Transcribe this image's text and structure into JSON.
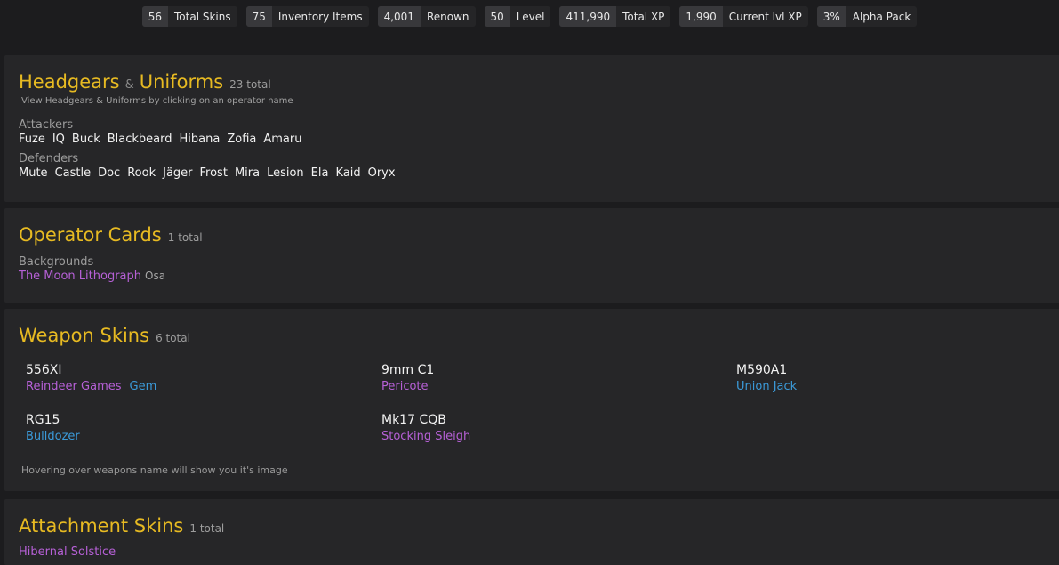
{
  "stats": [
    {
      "value": "56",
      "label": "Total Skins"
    },
    {
      "value": "75",
      "label": "Inventory Items"
    },
    {
      "value": "4,001",
      "label": "Renown"
    },
    {
      "value": "50",
      "label": "Level"
    },
    {
      "value": "411,990",
      "label": "Total XP"
    },
    {
      "value": "1,990",
      "label": "Current lvl XP"
    },
    {
      "value": "3%",
      "label": "Alpha Pack"
    }
  ],
  "headgears": {
    "title_a": "Headgears",
    "amp": "&",
    "title_b": "Uniforms",
    "total": "23 total",
    "hint": "View Headgears & Uniforms by clicking on an operator name",
    "attackers_label": "Attackers",
    "attackers": [
      "Fuze",
      "IQ",
      "Buck",
      "Blackbeard",
      "Hibana",
      "Zofia",
      "Amaru"
    ],
    "defenders_label": "Defenders",
    "defenders": [
      "Mute",
      "Castle",
      "Doc",
      "Rook",
      "Jäger",
      "Frost",
      "Mira",
      "Lesion",
      "Ela",
      "Kaid",
      "Oryx"
    ]
  },
  "operator_cards": {
    "title": "Operator Cards",
    "total": "1 total",
    "backgrounds_label": "Backgrounds",
    "item_name": "The Moon Lithograph",
    "item_owner": "Osa"
  },
  "weapon_skins": {
    "title": "Weapon Skins",
    "total": "6 total",
    "weapons": [
      {
        "name": "556XI",
        "skins": [
          {
            "name": "Reindeer Games",
            "color": "#b660d6"
          },
          {
            "name": "Gem",
            "color": "#3b9ad9"
          }
        ]
      },
      {
        "name": "9mm C1",
        "skins": [
          {
            "name": "Pericote",
            "color": "#b660d6"
          }
        ]
      },
      {
        "name": "M590A1",
        "skins": [
          {
            "name": "Union Jack",
            "color": "#3b9ad9"
          }
        ]
      },
      {
        "name": "RG15",
        "skins": [
          {
            "name": "Bulldozer",
            "color": "#3b9ad9"
          }
        ]
      },
      {
        "name": "Mk17 CQB",
        "skins": [
          {
            "name": "Stocking Sleigh",
            "color": "#b660d6"
          }
        ]
      }
    ],
    "footnote": "Hovering over weapons name will show you it's image"
  },
  "attachment_skins": {
    "title": "Attachment Skins",
    "total": "1 total",
    "item_name": "Hibernal Solstice"
  },
  "colors": {
    "accent": "#e7ba22",
    "rarity_epic": "#b660d6",
    "rarity_rare": "#3b9ad9",
    "background": "#1c1c1e",
    "panel": "#262628"
  }
}
